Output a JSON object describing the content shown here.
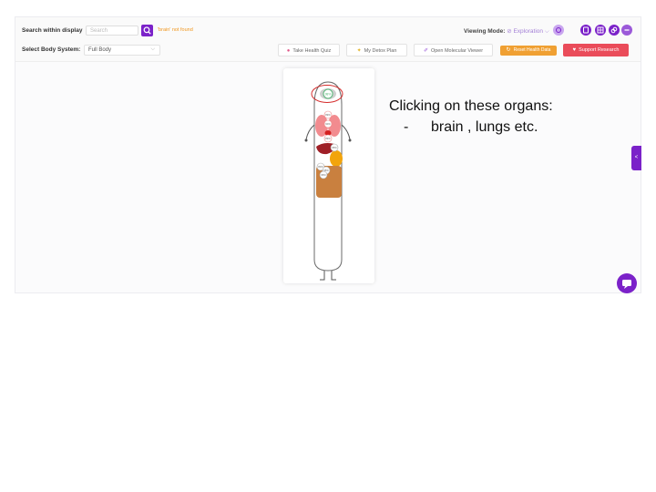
{
  "header": {
    "search_label": "Search within display",
    "search_placeholder": "Search",
    "search_status": "'brain' not found",
    "body_system_label": "Select Body System:",
    "body_system_value": "Full Body",
    "viewing_mode_label": "Viewing Mode:",
    "viewing_mode_value": "Exploration",
    "buttons": {
      "quiz": "Take Health Quiz",
      "detox": "My Detox Plan",
      "molecular": "Open Molecular Viewer",
      "reset": "Reset Health Data",
      "support": "Support Research"
    }
  },
  "body": {
    "organ_badges": [
      "98%",
      "89%",
      "90%",
      "89%",
      "95%",
      "80%",
      "95%",
      "95%"
    ]
  },
  "annotation": {
    "title": "Clicking on these organs:",
    "item": "brain , lungs etc."
  },
  "colors": {
    "accent": "#7b22c9",
    "reset": "#f0a032",
    "support": "#ea4c5a",
    "highlight_circle": "#d42a2a"
  }
}
